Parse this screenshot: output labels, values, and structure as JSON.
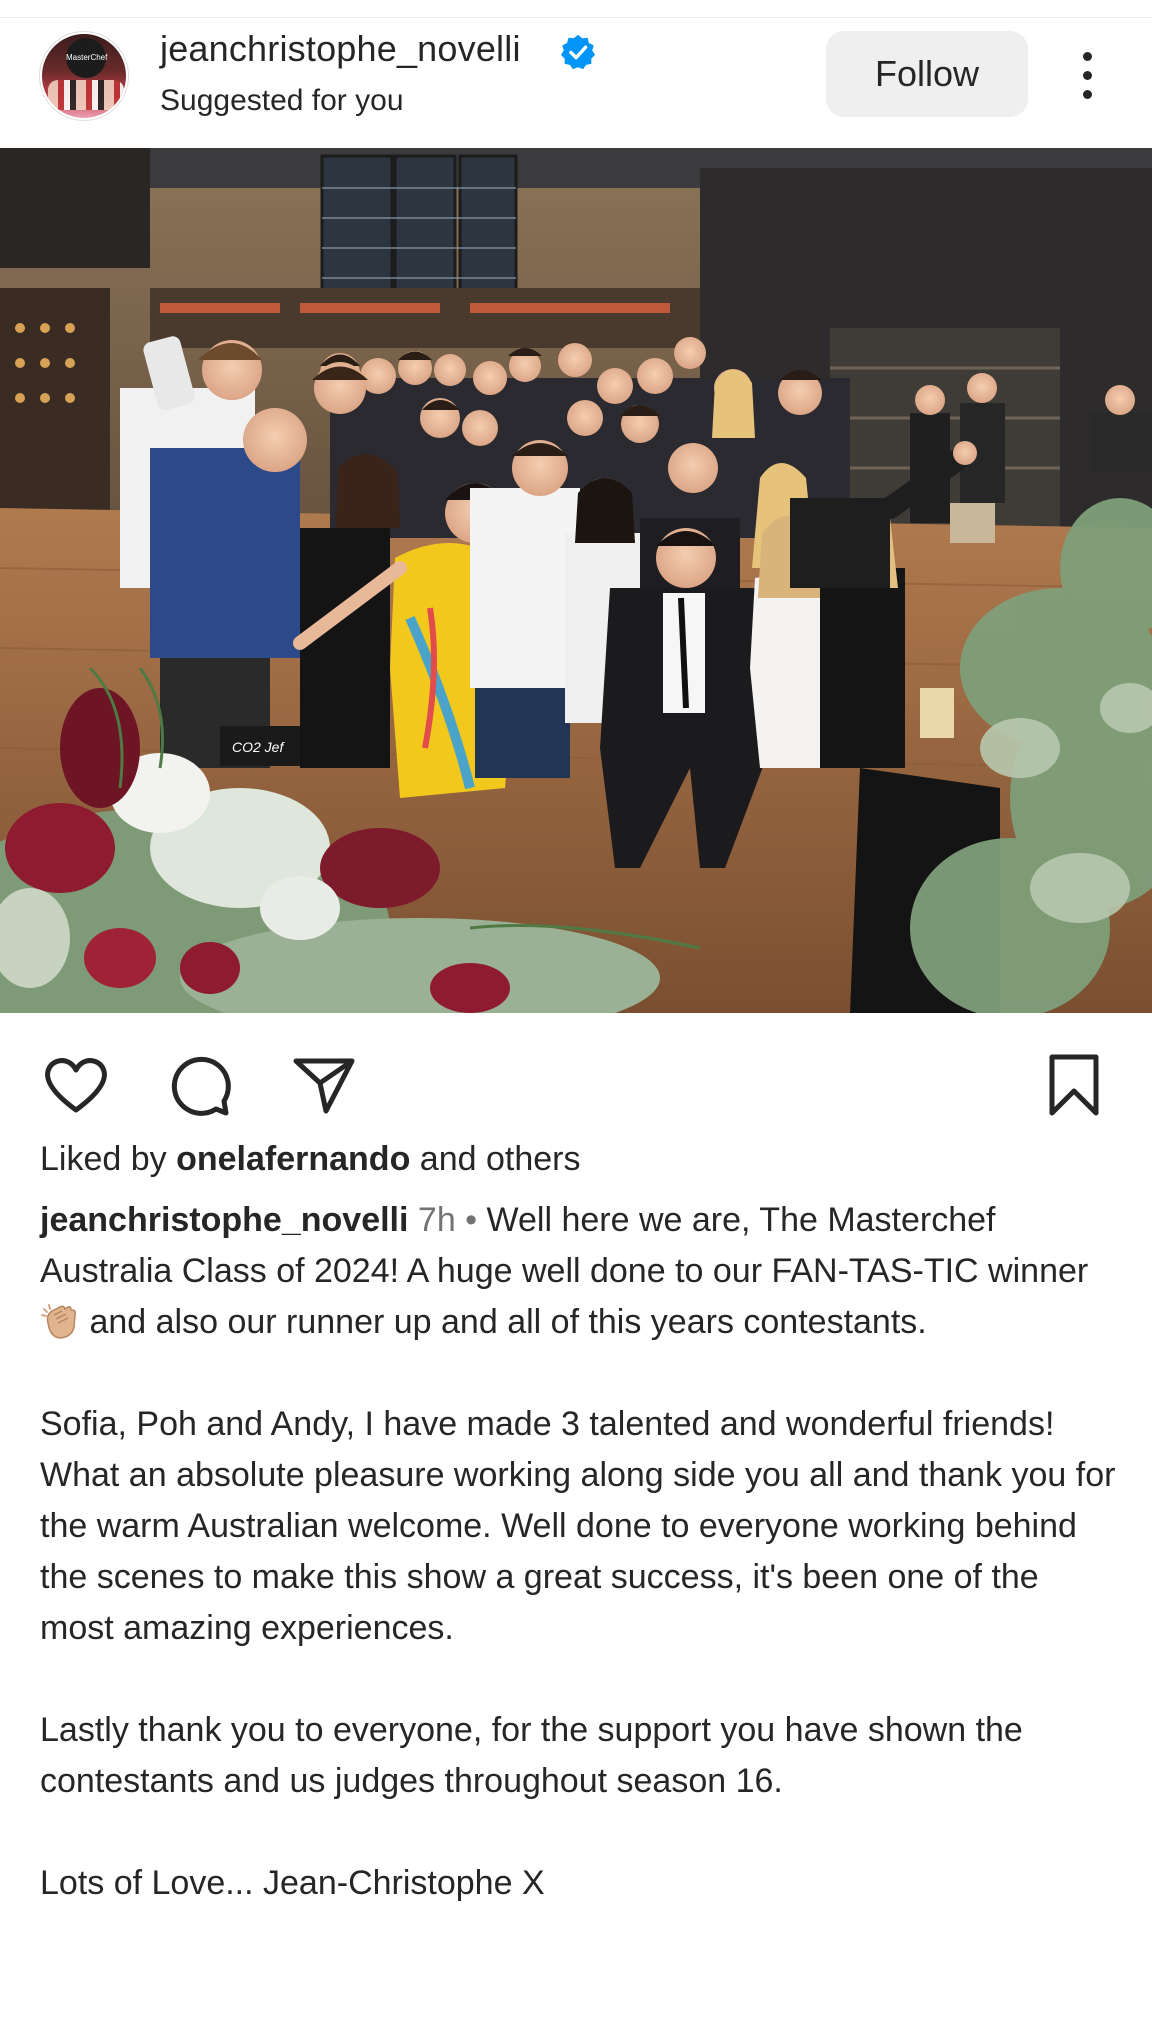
{
  "post": {
    "username": "jeanchristophe_novelli",
    "subtitle": "Suggested for you",
    "follow_label": "Follow",
    "avatar_text": "MasterChef",
    "verified": true
  },
  "photo": {
    "sign_text": "CO2 Jef"
  },
  "actions": {
    "like_icon": "heart-icon",
    "comment_icon": "comment-icon",
    "share_icon": "send-icon",
    "save_icon": "bookmark-icon"
  },
  "likes": {
    "prefix": "Liked by ",
    "user": "onelafernando",
    "suffix": " and others"
  },
  "caption": {
    "username": "jeanchristophe_novelli",
    "time": "7h",
    "separator": " • ",
    "p1_a": "Well here we are, The Masterchef Australia Class of 2024! A huge well done to our FAN-TAS-TIC winner ",
    "p1_b": " and also our runner up and all of this years contestants.",
    "p2": "Sofia, Poh and Andy, I have made 3 talented and wonderful friends! What an absolute pleasure working along side you all and thank you for the warm Australian welcome. Well done to everyone working behind the scenes to make this show a great success, it's been one of the most amazing experiences.",
    "p3": "Lastly thank you to everyone, for the support you have shown the contestants and us judges throughout season 16.",
    "p4": "Lots of Love... Jean-Christophe X"
  },
  "colors": {
    "text": "#262626",
    "muted": "#737373",
    "verified_blue": "#0095f6",
    "follow_bg": "#efefef",
    "dress_yellow": "#f2c81d",
    "flower_red": "#8e1b2f"
  }
}
